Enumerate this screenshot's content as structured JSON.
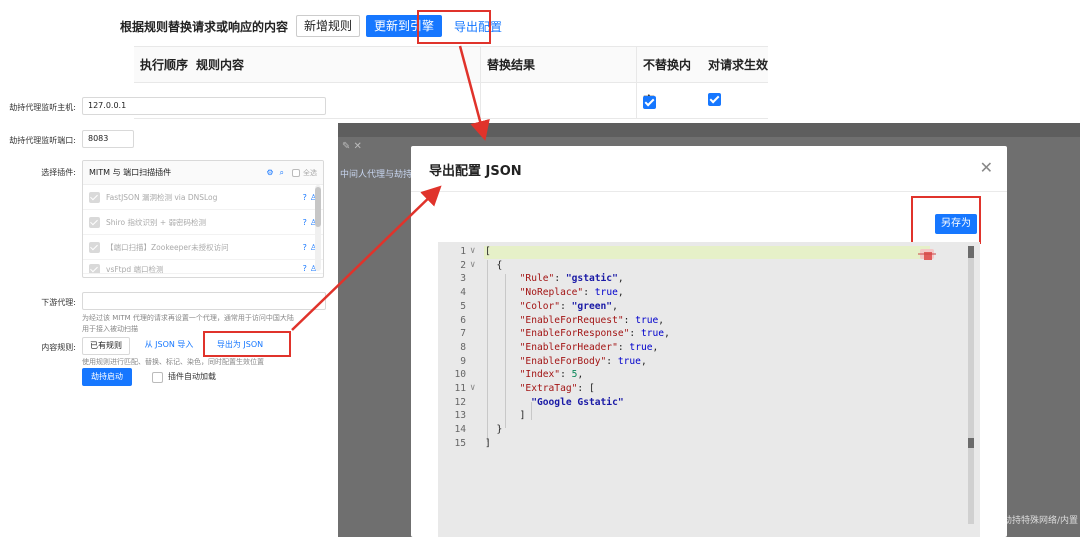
{
  "rules_panel": {
    "title": "根据规则替换请求或响应的内容",
    "btn_new_rule": "新增规则",
    "btn_update_engine": "更新到引擎",
    "btn_export_config": "导出配置",
    "columns": [
      "执行顺序",
      "规则内容",
      "替换结果",
      "不替换内容",
      "对请求生效"
    ]
  },
  "form": {
    "proxy_host_label": "劫持代理监听主机:",
    "proxy_host_value": "127.0.0.1",
    "proxy_port_label": "劫持代理监听端口:",
    "proxy_port_value": "8083",
    "plugin_label": "选择插件:",
    "plugin_header": "MITM 与 端口扫描插件",
    "select_all": "全选",
    "plugins": [
      "FastJSON 漏洞检测 via DNSLog",
      "Shiro 指纹识别 + 弱密码检测",
      "【端口扫描】Zookeeper未授权访问",
      "vsFtpd 端口检测"
    ],
    "downstream_label": "下游代理:",
    "downstream_hint": "为经过该 MITM 代理的请求再设置一个代理，通常用于访问中国大陆",
    "downstream_hint2": "用于接入被动扫描",
    "content_rules_label": "内容规则:",
    "btn_existing_rules": "已有规则",
    "btn_import_json": "从 JSON 导入",
    "btn_export_json": "导出为 JSON",
    "content_rules_hint": "使用规则进行匹配、替换、标记、染色，同时配置生效位置",
    "btn_start": "劫持启动",
    "auto_load_label": "插件自动加载"
  },
  "overlay": {
    "tab_text": "中间人代理与劫持",
    "footer_text": "劫持特殊网络/内置"
  },
  "modal": {
    "title": "导出配置 JSON",
    "close_icon": "close-icon",
    "save_as": "另存为"
  },
  "code": [
    {
      "n": "1",
      "fold": "∨",
      "text": "["
    },
    {
      "n": "2",
      "fold": "∨",
      "text": "  {"
    },
    {
      "n": "3",
      "fold": "",
      "key": "\"Rule\"",
      "val": "\"gstatic\"",
      "vtype": "s",
      "tail": ","
    },
    {
      "n": "4",
      "fold": "",
      "key": "\"NoReplace\"",
      "val": "true",
      "vtype": "b",
      "tail": ","
    },
    {
      "n": "5",
      "fold": "",
      "key": "\"Color\"",
      "val": "\"green\"",
      "vtype": "s",
      "tail": ","
    },
    {
      "n": "6",
      "fold": "",
      "key": "\"EnableForRequest\"",
      "val": "true",
      "vtype": "b",
      "tail": ","
    },
    {
      "n": "7",
      "fold": "",
      "key": "\"EnableForResponse\"",
      "val": "true",
      "vtype": "b",
      "tail": ","
    },
    {
      "n": "8",
      "fold": "",
      "key": "\"EnableForHeader\"",
      "val": "true",
      "vtype": "b",
      "tail": ","
    },
    {
      "n": "9",
      "fold": "",
      "key": "\"EnableForBody\"",
      "val": "true",
      "vtype": "b",
      "tail": ","
    },
    {
      "n": "10",
      "fold": "",
      "key": "\"Index\"",
      "val": "5",
      "vtype": "n",
      "tail": ","
    },
    {
      "n": "11",
      "fold": "∨",
      "key": "\"ExtraTag\"",
      "val": "[",
      "vtype": "p",
      "tail": ""
    },
    {
      "n": "12",
      "fold": "",
      "text": "        \"Google Gstatic\"",
      "cls": "s"
    },
    {
      "n": "13",
      "fold": "",
      "text": "      ]"
    },
    {
      "n": "14",
      "fold": "",
      "text": "  }"
    },
    {
      "n": "15",
      "fold": "",
      "text": "]"
    }
  ],
  "colors": {
    "accent": "#1677ff",
    "highlight": "#e0332b",
    "overlay": "#6f6f6f"
  }
}
